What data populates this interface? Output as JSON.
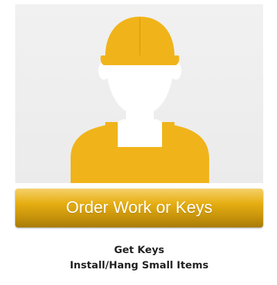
{
  "button": {
    "label": "Order Work or Keys"
  },
  "details": {
    "items": [
      "Get Keys",
      "Install/Hang Small Items"
    ]
  },
  "icon": {
    "name": "worker-icon",
    "color": "#f0b41a",
    "background": "#eeeeee",
    "face_color": "#ffffff"
  }
}
